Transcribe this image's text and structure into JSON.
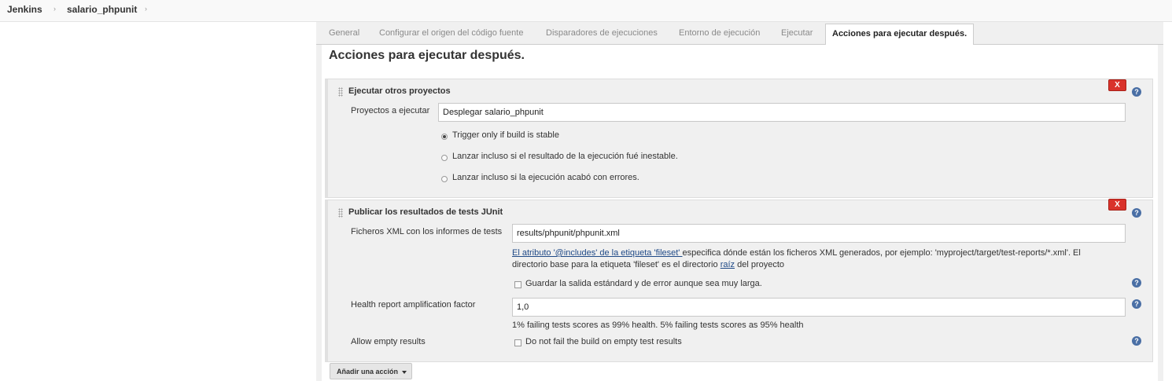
{
  "breadcrumb": {
    "items": [
      "Jenkins",
      "salario_phpunit"
    ],
    "separator": "›"
  },
  "tabs": [
    "General",
    "Configurar el origen del código fuente",
    "Disparadores de ejecuciones",
    "Entorno de ejecución",
    "Ejecutar",
    "Acciones para ejecutar después."
  ],
  "active_tab_index": 5,
  "section": {
    "title": "Acciones para ejecutar después."
  },
  "build_other_projects": {
    "title": "Ejecutar otros proyectos",
    "delete_label": "X",
    "help_label": "?",
    "projects_label": "Proyectos a ejecutar",
    "projects_value": "Desplegar salario_phpunit",
    "options": [
      {
        "label": "Trigger only if build is stable",
        "checked": true
      },
      {
        "label": "Lanzar incluso si el resultado de la ejecución fué inestable.",
        "checked": false
      },
      {
        "label": "Lanzar incluso si la ejecución acabó con errores.",
        "checked": false
      }
    ]
  },
  "junit": {
    "title": "Publicar los resultados de tests JUnit",
    "delete_label": "X",
    "help_label": "?",
    "xml_label": "Ficheros XML con los informes de tests",
    "xml_value": "results/phpunit/phpunit.xml",
    "help_link1": "El atributo '@includes' de la etiqueta 'fileset' ",
    "help_text1": "especifica dónde están los ficheros XML generados, por ejemplo: 'myproject/target/test-reports/*.xml'. El",
    "help_text2": "directorio base para la etiqueta 'fileset' es el directorio ",
    "help_link2": "raíz",
    "help_text3": " del proyecto",
    "keep_output_label": "Guardar la salida estándard y de error aunque sea muy larga.",
    "keep_output_checked": false,
    "health_label": "Health report amplification factor",
    "health_value": "1,0",
    "health_hint": "1% failing tests scores as 99% health. 5% failing tests scores as 95% health",
    "allow_empty_label": "Allow empty results",
    "allow_empty_option": "Do not fail the build on empty test results",
    "allow_empty_checked": false
  },
  "add_action_label": "Añadir una acción",
  "colors": {
    "delete_button": "#d9322b",
    "help_icon": "#4a6fa5",
    "link": "#204a87"
  }
}
